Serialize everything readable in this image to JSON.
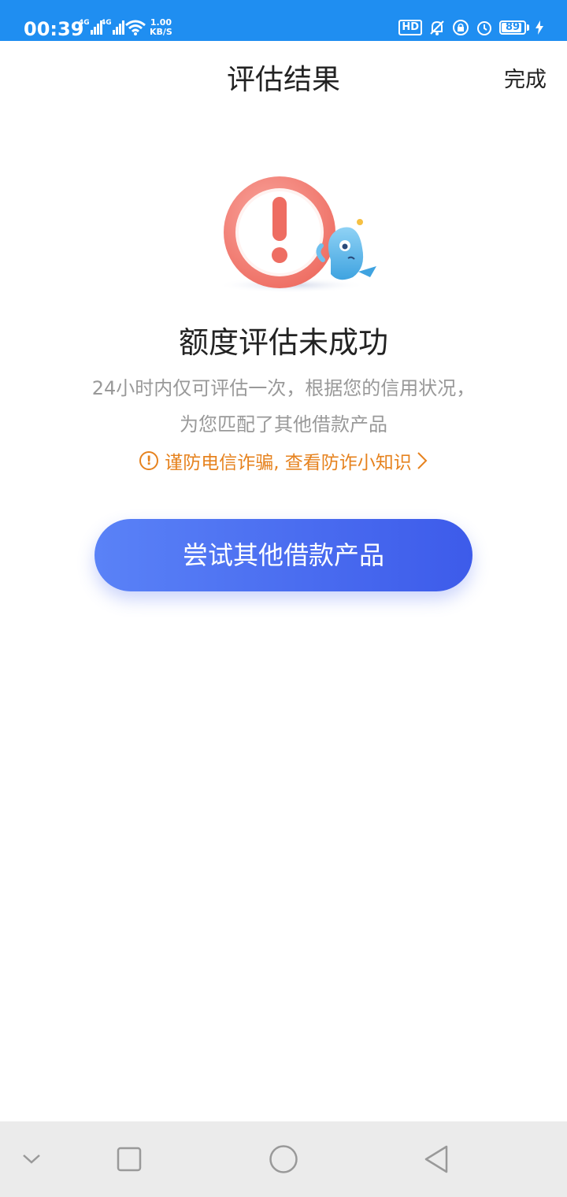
{
  "status_bar": {
    "time": "00:39",
    "network_1": "4G",
    "network_2": "4G",
    "speed_value": "1.00",
    "speed_unit": "KB/S",
    "hd_label": "HD",
    "battery_level": 89,
    "battery_text": "89"
  },
  "header": {
    "title": "评估结果",
    "done_label": "完成"
  },
  "result": {
    "title": "额度评估未成功",
    "description_line1": "24小时内仅可评估一次，根据您的信用状况，",
    "description_line2": "为您匹配了其他借款产品",
    "warning_text": "谨防电信诈骗, 查看防诈小知识"
  },
  "actions": {
    "cta_label": "尝试其他借款产品"
  },
  "colors": {
    "status_bar": "#1f8ef1",
    "warning": "#e6821e",
    "cta_start": "#5a82f7",
    "cta_end": "#3d5bea",
    "alert_red": "#f07b72"
  },
  "icons": {
    "illustration": "warning-mascot-illustration",
    "warning": "exclamation-circle-icon",
    "chevron": "chevron-right-icon",
    "nav": [
      "chevron-down-icon",
      "square-icon",
      "circle-icon",
      "triangle-back-icon"
    ]
  }
}
